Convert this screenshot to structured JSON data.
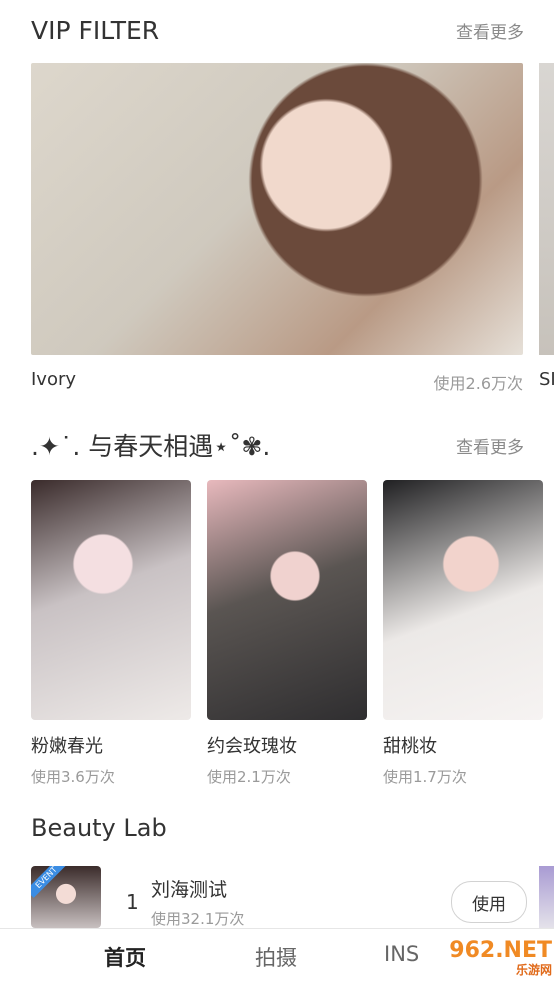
{
  "vip": {
    "title": "VIP FILTER",
    "more": "查看更多",
    "item_name": "Ivory",
    "item_usage": "使用2.6万次",
    "peek_label": "SI"
  },
  "spring": {
    "title": ".✦˙. 与春天相遇⋆˚✾.",
    "more": "查看更多",
    "items": [
      {
        "name": "粉嫩春光",
        "usage": "使用3.6万次"
      },
      {
        "name": "约会玫瑰妆",
        "usage": "使用2.1万次"
      },
      {
        "name": "甜桃妆",
        "usage": "使用1.7万次"
      }
    ]
  },
  "lab": {
    "title": "Beauty Lab",
    "badge": "EVENT",
    "rank": "1",
    "name": "刘海测试",
    "usage": "使用32.1万次",
    "button": "使用"
  },
  "tabs": [
    {
      "label": "首页"
    },
    {
      "label": "拍摄"
    },
    {
      "label": "INS"
    }
  ],
  "watermark": {
    "line1": "962.NET",
    "line2": "乐游网"
  }
}
